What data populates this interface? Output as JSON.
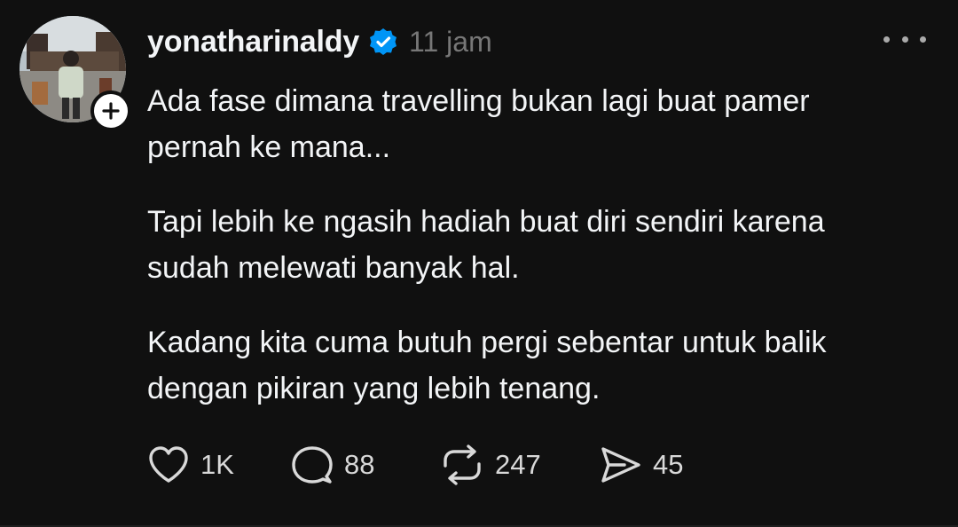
{
  "post": {
    "username": "yonatharinaldy",
    "time": "11 jam",
    "paragraphs": [
      "Ada fase dimana travelling bukan lagi buat pamer\npernah ke mana...",
      "Tapi lebih ke ngasih hadiah buat diri sendiri karena\nsudah melewati banyak hal.",
      "Kadang kita cuma butuh pergi sebentar untuk balik\ndengan pikiran yang lebih tenang."
    ],
    "actions": {
      "likes": "1K",
      "replies": "88",
      "reposts": "247",
      "shares": "45"
    }
  },
  "icons": {
    "verified": "verified-badge-icon",
    "follow": "plus-icon",
    "more": "more-dots-icon",
    "like": "heart-icon",
    "reply": "comment-icon",
    "repost": "repost-icon",
    "share": "send-icon"
  },
  "colors": {
    "background": "#101010",
    "text": "#f3f5f7",
    "muted": "#777777",
    "verified": "#0095f6"
  }
}
